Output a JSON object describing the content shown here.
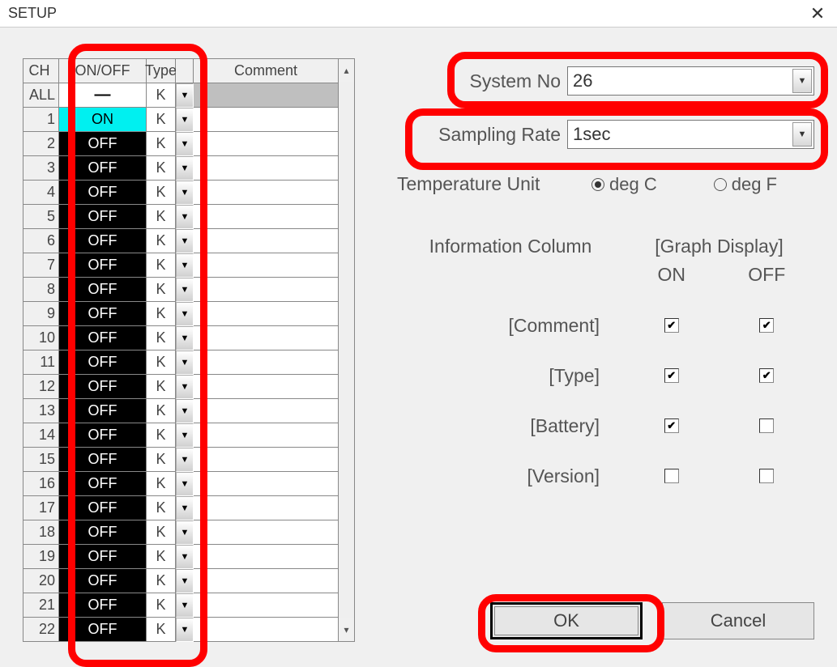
{
  "title": "SETUP",
  "headers": {
    "ch": "CH",
    "onoff": "ON/OFF",
    "type": "Type",
    "comment": "Comment"
  },
  "all_row": {
    "label": "ALL",
    "onoff": "―",
    "type": "K"
  },
  "rows": [
    {
      "ch": "1",
      "onoff": "ON",
      "type": "K",
      "comment": ""
    },
    {
      "ch": "2",
      "onoff": "OFF",
      "type": "K",
      "comment": ""
    },
    {
      "ch": "3",
      "onoff": "OFF",
      "type": "K",
      "comment": ""
    },
    {
      "ch": "4",
      "onoff": "OFF",
      "type": "K",
      "comment": ""
    },
    {
      "ch": "5",
      "onoff": "OFF",
      "type": "K",
      "comment": ""
    },
    {
      "ch": "6",
      "onoff": "OFF",
      "type": "K",
      "comment": ""
    },
    {
      "ch": "7",
      "onoff": "OFF",
      "type": "K",
      "comment": ""
    },
    {
      "ch": "8",
      "onoff": "OFF",
      "type": "K",
      "comment": ""
    },
    {
      "ch": "9",
      "onoff": "OFF",
      "type": "K",
      "comment": ""
    },
    {
      "ch": "10",
      "onoff": "OFF",
      "type": "K",
      "comment": ""
    },
    {
      "ch": "11",
      "onoff": "OFF",
      "type": "K",
      "comment": ""
    },
    {
      "ch": "12",
      "onoff": "OFF",
      "type": "K",
      "comment": ""
    },
    {
      "ch": "13",
      "onoff": "OFF",
      "type": "K",
      "comment": ""
    },
    {
      "ch": "14",
      "onoff": "OFF",
      "type": "K",
      "comment": ""
    },
    {
      "ch": "15",
      "onoff": "OFF",
      "type": "K",
      "comment": ""
    },
    {
      "ch": "16",
      "onoff": "OFF",
      "type": "K",
      "comment": ""
    },
    {
      "ch": "17",
      "onoff": "OFF",
      "type": "K",
      "comment": ""
    },
    {
      "ch": "18",
      "onoff": "OFF",
      "type": "K",
      "comment": ""
    },
    {
      "ch": "19",
      "onoff": "OFF",
      "type": "K",
      "comment": ""
    },
    {
      "ch": "20",
      "onoff": "OFF",
      "type": "K",
      "comment": ""
    },
    {
      "ch": "21",
      "onoff": "OFF",
      "type": "K",
      "comment": ""
    },
    {
      "ch": "22",
      "onoff": "OFF",
      "type": "K",
      "comment": ""
    }
  ],
  "system_no": {
    "label": "System No",
    "value": "26"
  },
  "sampling_rate": {
    "label": "Sampling Rate",
    "value": "1sec"
  },
  "temp_unit": {
    "label": "Temperature Unit",
    "degc": "deg C",
    "degf": "deg F",
    "selected": "C"
  },
  "info": {
    "column_label": "Information Column",
    "group_label": "[Graph Display]",
    "on": "ON",
    "off": "OFF",
    "rows": [
      {
        "label": "[Comment]",
        "on": true,
        "off": true
      },
      {
        "label": "[Type]",
        "on": true,
        "off": true
      },
      {
        "label": "[Battery]",
        "on": true,
        "off": false
      },
      {
        "label": "[Version]",
        "on": false,
        "off": false
      }
    ]
  },
  "buttons": {
    "ok": "OK",
    "cancel": "Cancel"
  }
}
